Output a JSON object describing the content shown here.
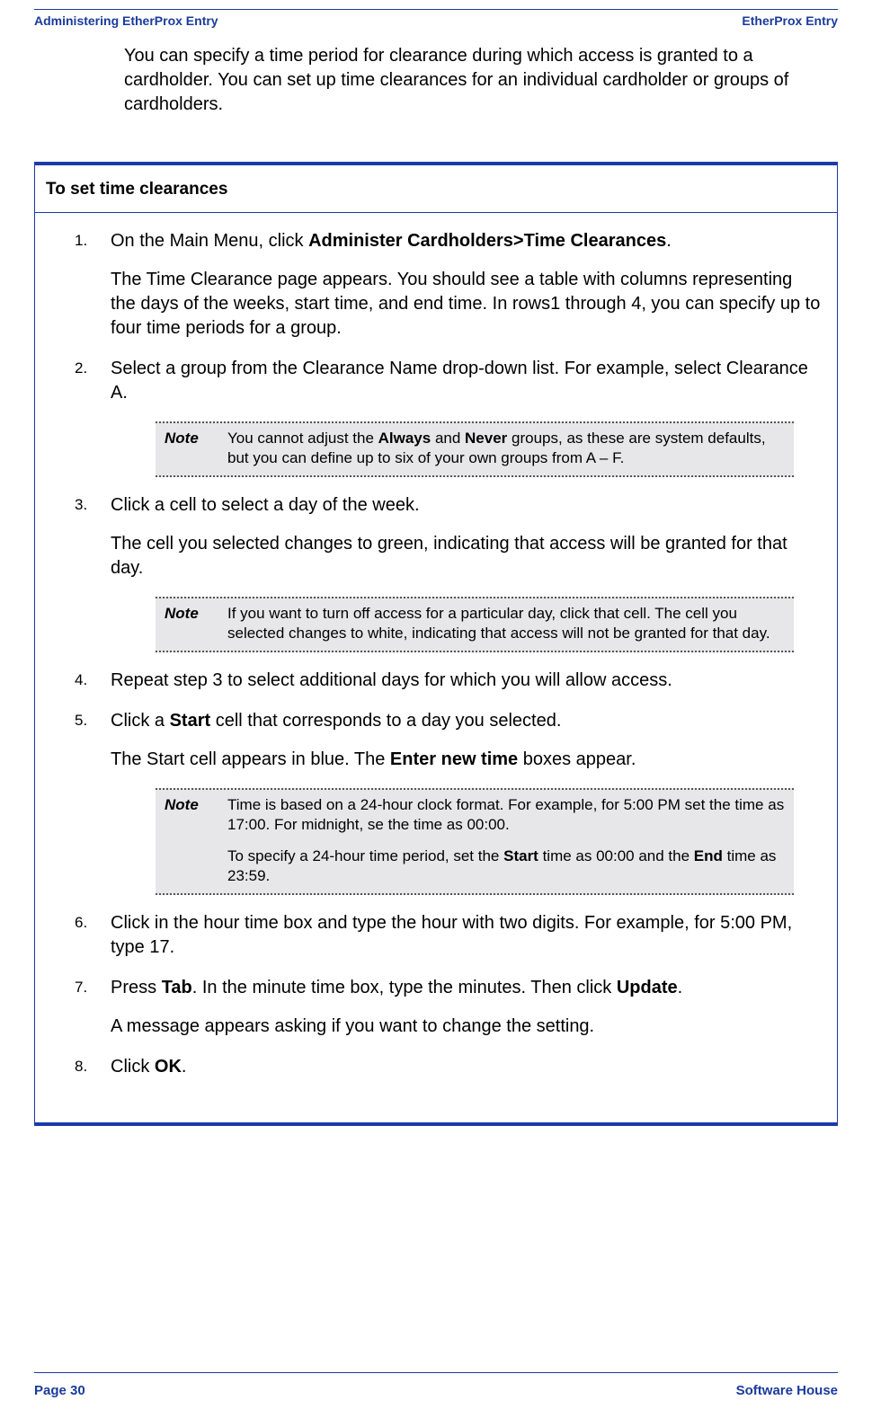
{
  "header": {
    "left": "Administering EtherProx Entry",
    "right": "EtherProx Entry"
  },
  "intro": "You can specify a time period for clearance during which access is granted to a cardholder. You can set up time clearances for an individual cardholder or groups of cardholders.",
  "proc": {
    "title": "To set time clearances",
    "steps": [
      {
        "pre": "On the Main Menu, click ",
        "bold1": "Administer Cardholders>Time Clearances",
        "post": ".",
        "para": "The Time Clearance page appears. You should see a table with columns representing the days of the weeks, start time, and end time. In rows1 through 4, you can specify up to four time periods for a group."
      },
      {
        "text": "Select a group from the Clearance Name drop-down list. For example, select Clearance A.",
        "note_pre": "You cannot adjust the ",
        "note_b1": "Always",
        "note_mid": " and ",
        "note_b2": "Never",
        "note_post": " groups, as these are system defaults, but you can define up to six of your own groups from A – F."
      },
      {
        "text": "Click a cell to select a day of the week.",
        "para": "The cell you selected changes to green, indicating that access will be granted for that day.",
        "note": "If you want to turn off access for a particular day, click that cell. The cell you selected changes to white, indicating that access will not be granted for that day."
      },
      {
        "text": "Repeat step 3 to select additional days for which you will allow access."
      },
      {
        "pre": "Click a ",
        "bold1": "Start",
        "post": " cell that corresponds to a day you selected.",
        "para_pre": "The Start cell appears in blue. The ",
        "para_bold": "Enter new time",
        "para_post": " boxes appear.",
        "note": "Time is based on a 24-hour clock format. For example, for 5:00 PM set the time as 17:00. For midnight, se the time as 00:00.",
        "note_extra_pre": "To specify a 24-hour time period, set the ",
        "note_extra_b1": "Start",
        "note_extra_mid": " time as 00:00 and the ",
        "note_extra_b2": "End",
        "note_extra_post": " time as 23:59."
      },
      {
        "text": "Click in the hour time box and type the hour with two digits. For example, for 5:00 PM, type 17."
      },
      {
        "pre": "Press ",
        "bold1": "Tab",
        "mid": ". In the minute time box, type the minutes. Then click ",
        "bold2": "Update",
        "post": ".",
        "para": "A message appears asking if you want to change the setting."
      },
      {
        "pre": "Click ",
        "bold1": "OK",
        "post": "."
      }
    ]
  },
  "note_label": "Note",
  "footer": {
    "left": "Page 30",
    "right": "Software House"
  }
}
